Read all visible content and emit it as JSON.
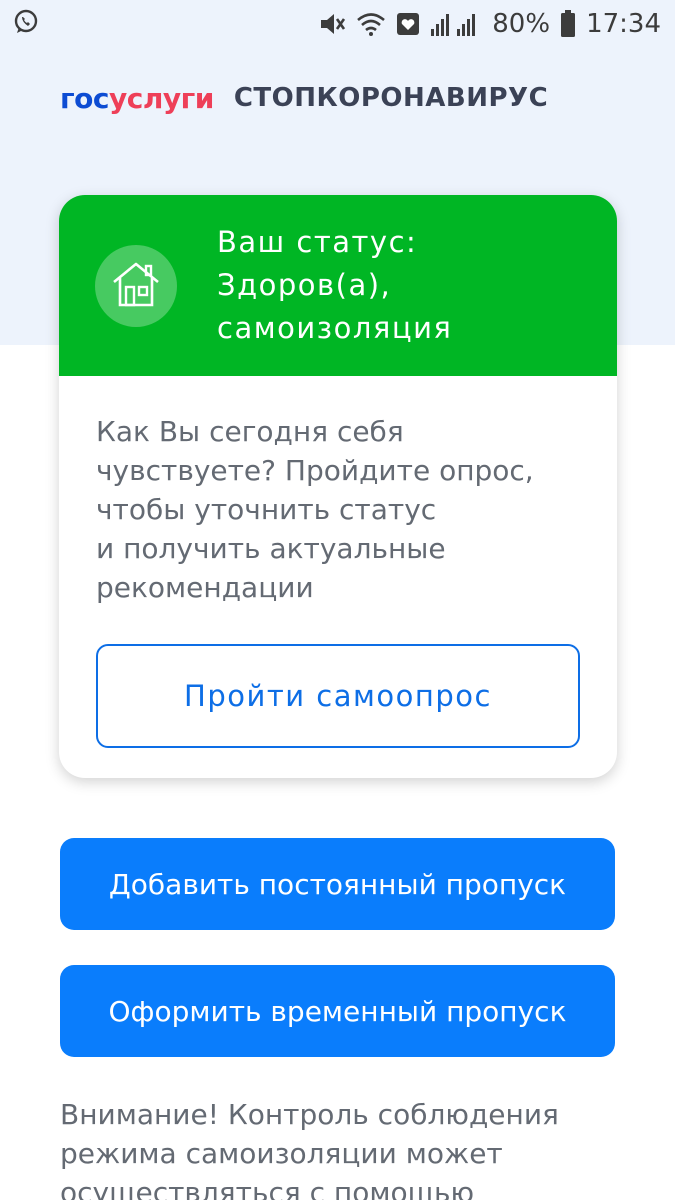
{
  "status_bar": {
    "battery": "80%",
    "time": "17:34"
  },
  "header": {
    "logo_gos": "гос",
    "logo_uslugi": "услуги",
    "app_title": "СТОПКОРОНАВИРУС"
  },
  "status_card": {
    "status_line1": "Ваш статус:",
    "status_line2": "Здоров(а),",
    "status_line3": "самоизоляция",
    "prompt_lines": [
      "Как Вы сегодня себя",
      "чувствуете? Пройдите опрос,",
      "чтобы уточнить статус",
      "и получить актуальные",
      "рекомендации"
    ],
    "survey_button": "Пройти самоопрос"
  },
  "actions": {
    "permanent_pass": "Добавить постоянный пропуск",
    "temporary_pass": "Оформить временный пропуск"
  },
  "warning_lines": [
    "Внимание! Контроль соблюдения",
    "режима самоизоляции может",
    "осуществляться с помощью"
  ],
  "colors": {
    "status_green": "#00b624",
    "primary_blue": "#0a7dfc",
    "logo_blue": "#0d4cd3",
    "logo_red": "#ee3f58"
  }
}
